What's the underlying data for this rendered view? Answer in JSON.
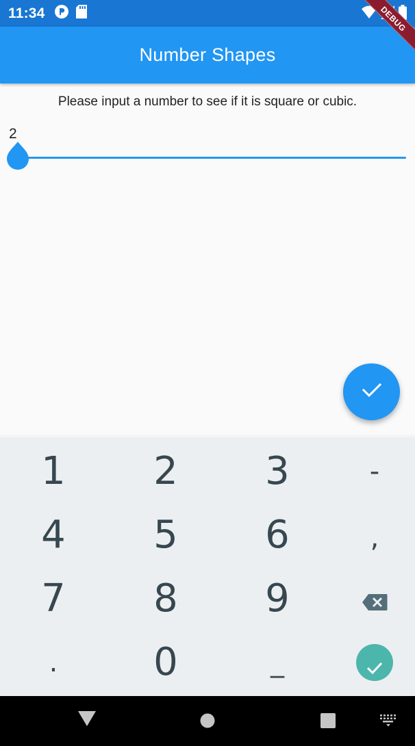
{
  "status_bar": {
    "time": "11:34",
    "icons": [
      "app-notification-icon",
      "sd-card-icon",
      "wifi-icon",
      "signal-icon",
      "battery-icon"
    ]
  },
  "debug_banner": "DEBUG",
  "app_bar": {
    "title": "Number Shapes"
  },
  "main": {
    "instruction": "Please input a number to see if it is square or cubic.",
    "slider": {
      "value_label": "2",
      "value": 2
    }
  },
  "fab": {
    "icon": "check-icon"
  },
  "keyboard": {
    "row1": [
      "1",
      "2",
      "3",
      "-"
    ],
    "row2": [
      "4",
      "5",
      "6",
      ","
    ],
    "row3": [
      "7",
      "8",
      "9"
    ],
    "row4": [
      ".",
      "0",
      "_"
    ],
    "backspace_icon": "backspace-icon",
    "enter_icon": "check-icon",
    "enter_color": "#4db6ac"
  },
  "nav_bar": {
    "icons": [
      "back-icon",
      "home-icon",
      "recents-icon",
      "keyboard-switch-icon"
    ]
  },
  "colors": {
    "primary": "#2196f3",
    "status_bar": "#1976d2"
  }
}
